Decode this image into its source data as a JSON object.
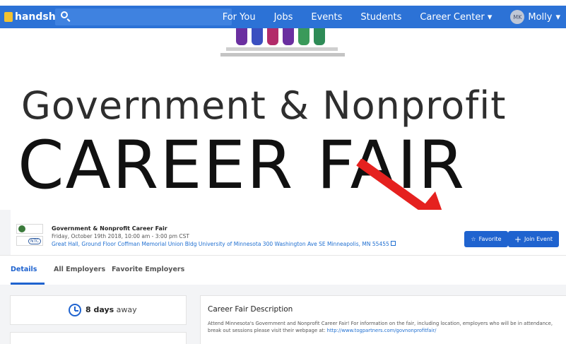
{
  "nav": {
    "brand": "handshake",
    "links": [
      "For You",
      "Jobs",
      "Events",
      "Students",
      "Career Center"
    ],
    "user_initials": "MK",
    "user_name": "Molly",
    "colors": {
      "bar": "#2c72d6",
      "brand_mark": "#f2c230"
    }
  },
  "hero": {
    "line1": "Government & Nonprofit",
    "line2": "CAREER FAIR"
  },
  "event": {
    "title": "Government & Nonprofit Career Fair",
    "date": "Friday, October 19th 2018, 10:00 am - 3:00 pm CST",
    "location": "Great Hall, Ground Floor Coffman Memorial Union Bldg University of Minnesota 300 Washington Ave SE Minneapolis, MN 55455",
    "school_logo_text": "NTC",
    "favorite_label": "Favorite",
    "join_label": "Join Event"
  },
  "tabs": [
    "Details",
    "All Employers",
    "Favorite Employers"
  ],
  "countdown": {
    "value": "8 days",
    "suffix": "away"
  },
  "description": {
    "title": "Career Fair Description",
    "body": "Attend Minnesota's Government and Nonprofit Career Fair!  For information on the fair, including location, employers who will be in attendance, break out sessions please visit their webpage at:",
    "link": "http://www.togpartners.com/govnonprofitfair/"
  },
  "annotation": {
    "arrow_color": "#e5211f"
  }
}
